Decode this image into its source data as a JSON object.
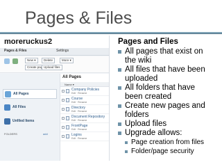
{
  "slide": {
    "title": "Pages & Files"
  },
  "screenshot": {
    "site_name": "moreruckus2",
    "tabs": [
      "Pages & Files",
      "Settings"
    ],
    "toolbar": {
      "new_label": "New ▾",
      "delete_label": "Delete",
      "more_label": "More ▾",
      "create_label": "Create page",
      "upload_label": "Upload files"
    },
    "sidebar": {
      "items": [
        {
          "label": "All Pages",
          "icon": "pages-icon",
          "color": "#6aa5d8"
        },
        {
          "label": "All Files",
          "icon": "files-icon",
          "color": "#4a86c5"
        },
        {
          "label": "Unfiled Items",
          "icon": "unfiled-icon",
          "color": "#3d6fa8"
        }
      ],
      "folders_label": "FOLDERS",
      "folders_add": "add"
    },
    "content": {
      "header": "All Pages",
      "column_header": "Name ▾",
      "rows": [
        {
          "name": "Company Policies",
          "meta": "Edit · Rename"
        },
        {
          "name": "Course",
          "meta": "Edit · Rename"
        },
        {
          "name": "Directory",
          "meta": "Edit · Rename"
        },
        {
          "name": "Document Repository",
          "meta": "Edit · Rename"
        },
        {
          "name": "FrontPage",
          "meta": "Edit · Rename"
        },
        {
          "name": "Logins",
          "meta": "Edit · Rename"
        }
      ]
    }
  },
  "bullets": {
    "heading": "Pages and Files",
    "items": [
      {
        "lines": [
          "All pages that exist on",
          "the wiki"
        ]
      },
      {
        "lines": [
          "All files that have been",
          "uploaded"
        ]
      },
      {
        "lines": [
          "All folders that have",
          "been created"
        ]
      },
      {
        "lines": [
          "Create new pages and",
          "folders"
        ]
      },
      {
        "lines": [
          "Upload files"
        ]
      },
      {
        "lines": [
          "Upgrade allows:"
        ]
      }
    ],
    "subitems": [
      "Page creation from files",
      "Folder/page security"
    ]
  },
  "colors": {
    "accent": "#7fa2b5",
    "bullet": "#6f93a8",
    "title": "#4d4d4d"
  }
}
